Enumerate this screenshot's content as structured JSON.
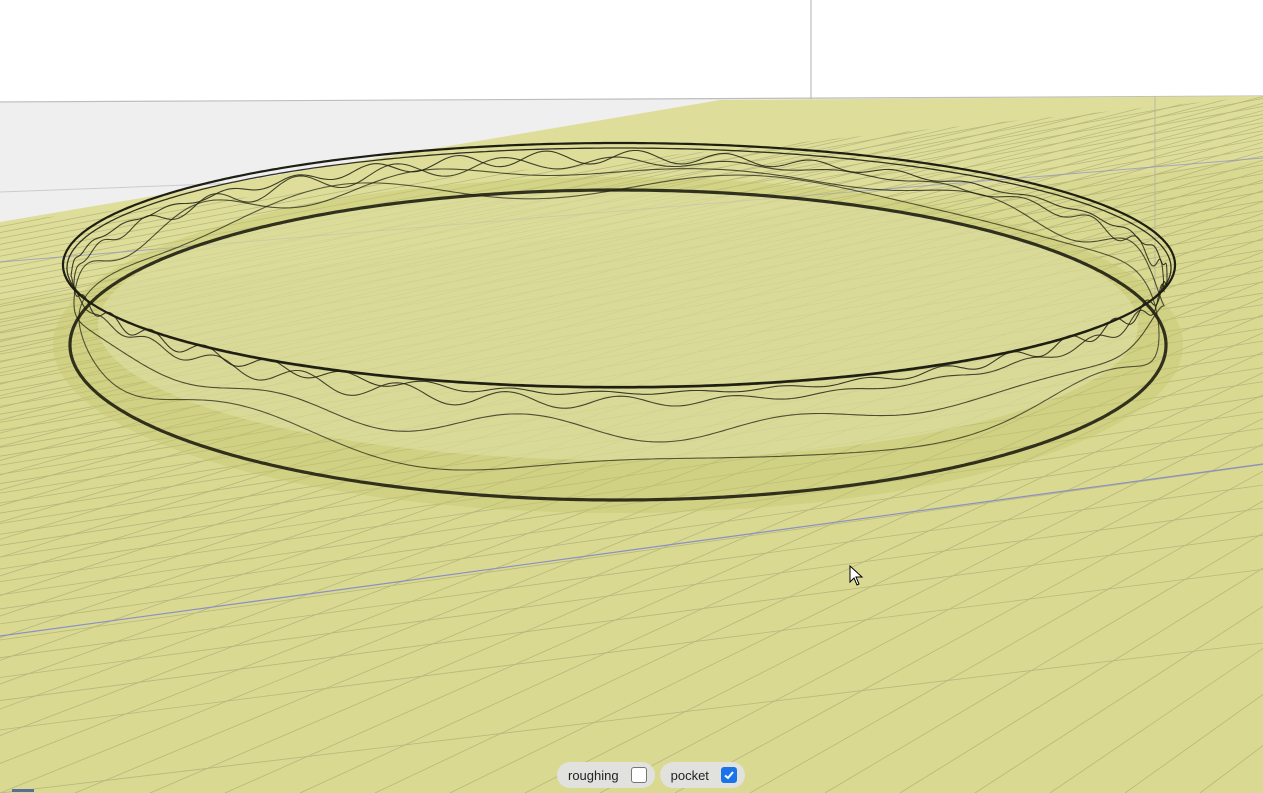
{
  "scene": {
    "description_icon": "cad-3d-viewport",
    "plane_color": "#d9d98a",
    "background_color": "#ffffff",
    "axis_color": "#8a8fc8"
  },
  "toggles": [
    {
      "label": "roughing",
      "checked": false
    },
    {
      "label": "pocket",
      "checked": true
    }
  ]
}
